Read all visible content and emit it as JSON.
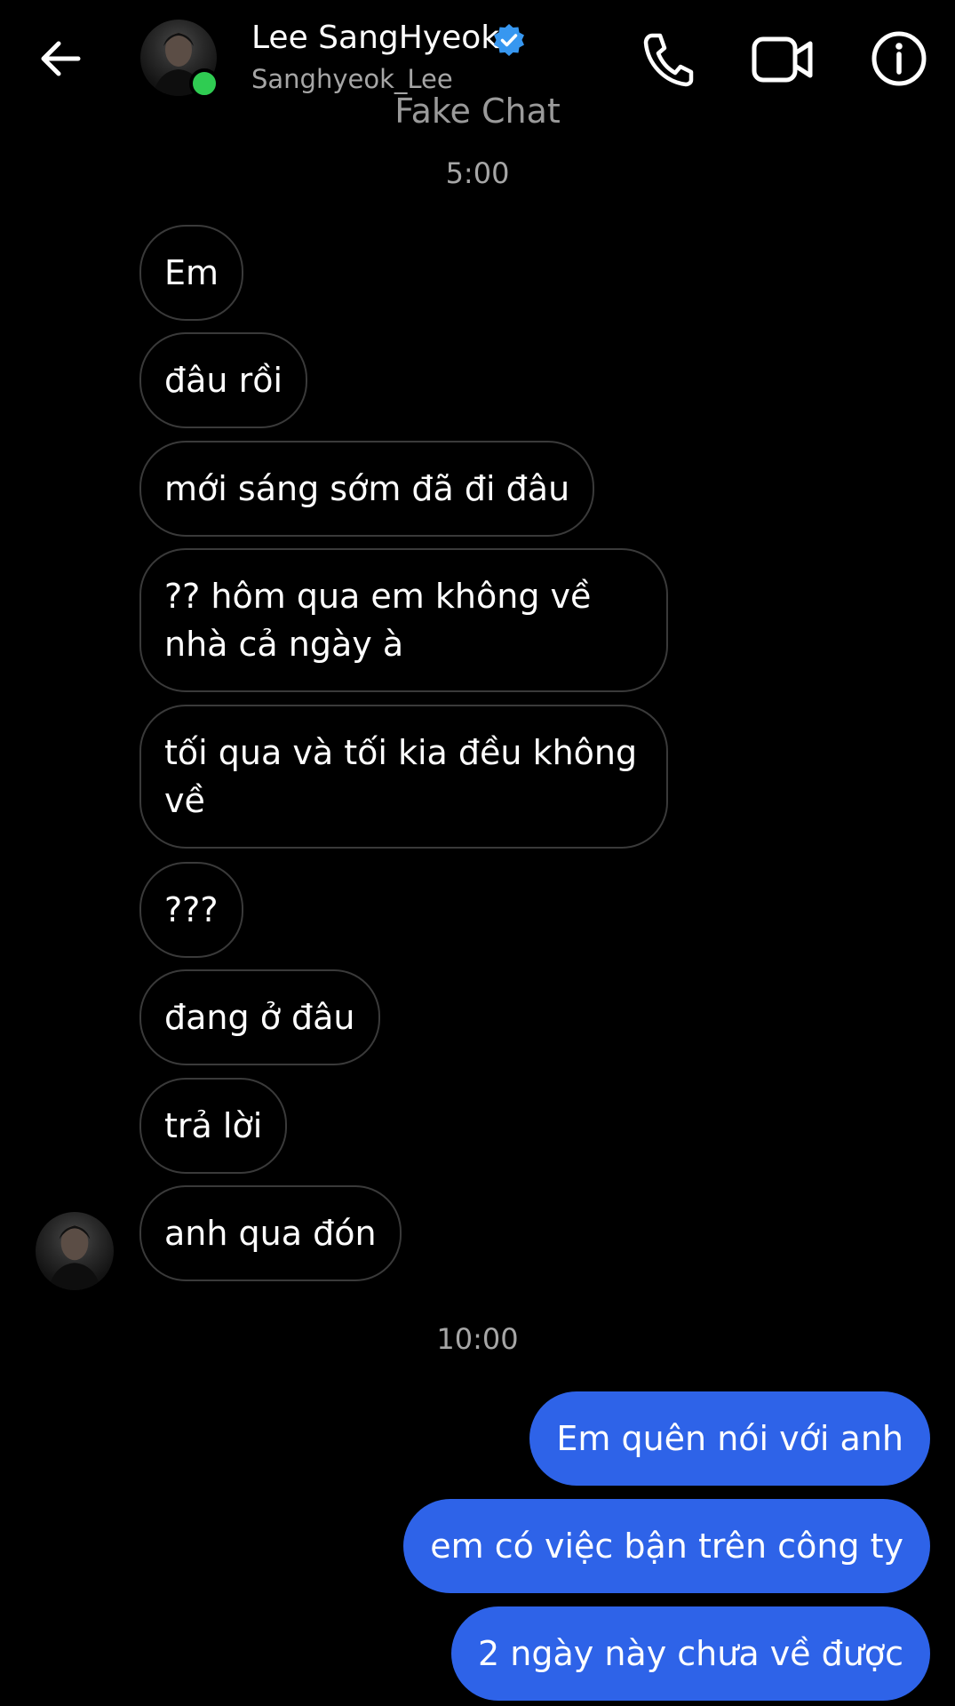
{
  "header": {
    "contact_name": "Lee SangHyeok",
    "contact_handle": "Sanghyeok_Lee",
    "watermark": "Fake Chat",
    "online_color": "#2fcc52",
    "verified_color": "#3797f0",
    "icons": [
      "back-arrow-icon",
      "phone-icon",
      "video-camera-icon",
      "info-icon",
      "verified-badge-icon"
    ]
  },
  "conversation": {
    "timestamp_1": "5:00",
    "timestamp_2": "10:00",
    "incoming": [
      "Em",
      "đâu rồi",
      "mới sáng sớm đã đi đâu",
      "?? hôm qua em không về\nnhà cả ngày à",
      "tối qua và tối kia đều không\nvề",
      "???",
      "đang ở đâu",
      "trả lời",
      "anh qua đón"
    ],
    "outgoing": [
      "Em quên nói với anh",
      "em có việc bận trên công ty",
      "2 ngày này chưa về được"
    ],
    "outgoing_bubble_color": "#2e63e8",
    "incoming_border_color": "#3a3a3a"
  }
}
